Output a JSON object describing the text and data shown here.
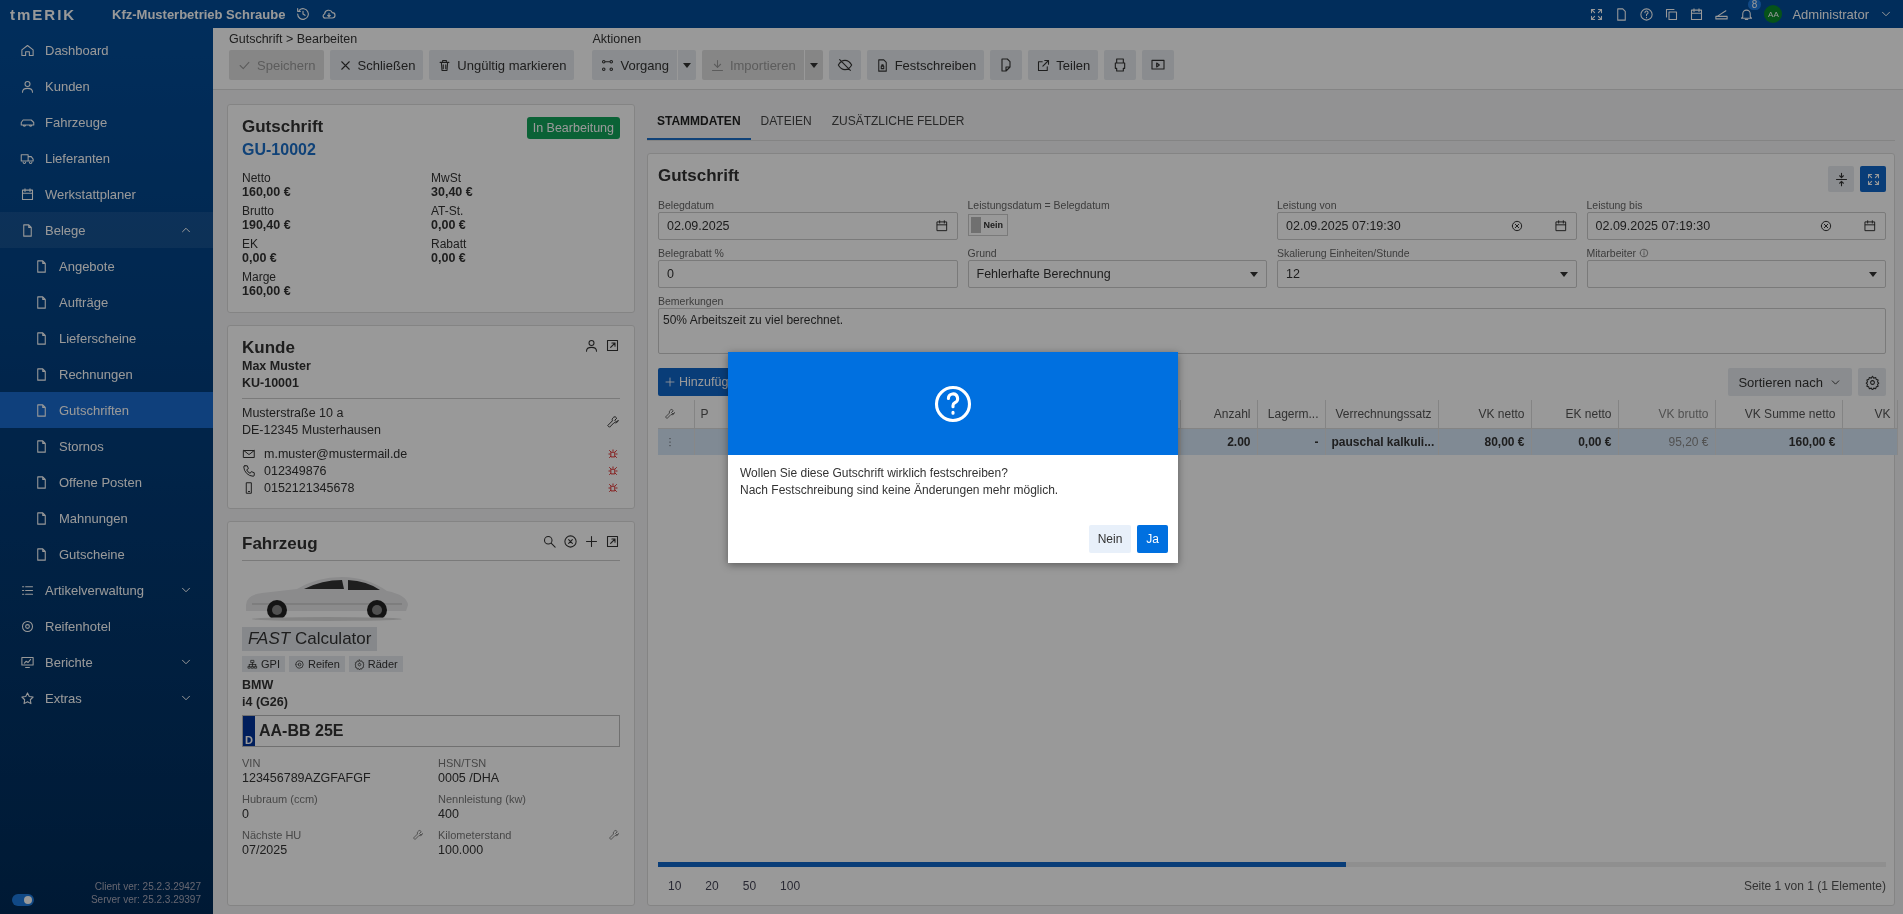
{
  "topbar": {
    "logo": "tmERIK",
    "company": "Kfz-Musterbetrieb Schraube",
    "notifications": "8",
    "avatar": "AA",
    "user": "Administrator"
  },
  "sidebar": {
    "items": [
      {
        "label": "Dashboard",
        "selected": false
      },
      {
        "label": "Kunden",
        "selected": false
      },
      {
        "label": "Fahrzeuge",
        "selected": false
      },
      {
        "label": "Lieferanten",
        "selected": false
      },
      {
        "label": "Werkstattplaner",
        "selected": false
      },
      {
        "label": "Belege",
        "selected": false,
        "expanded": true,
        "children": [
          {
            "label": "Angebote",
            "selected": false
          },
          {
            "label": "Aufträge",
            "selected": false
          },
          {
            "label": "Lieferscheine",
            "selected": false
          },
          {
            "label": "Rechnungen",
            "selected": false
          },
          {
            "label": "Gutschriften",
            "selected": true
          },
          {
            "label": "Stornos",
            "selected": false
          },
          {
            "label": "Offene Posten",
            "selected": false
          },
          {
            "label": "Mahnungen",
            "selected": false
          },
          {
            "label": "Gutscheine",
            "selected": false
          }
        ]
      },
      {
        "label": "Artikelverwaltung",
        "selected": false,
        "expanded": false
      },
      {
        "label": "Reifenhotel",
        "selected": false
      },
      {
        "label": "Berichte",
        "selected": false,
        "expanded": false
      },
      {
        "label": "Extras",
        "selected": false,
        "expanded": false
      }
    ],
    "toggle_on": true,
    "client_version": "Client ver: 25.2.3.29427",
    "server_version": "Server ver: 25.2.3.29397"
  },
  "toolbar": {
    "groups": [
      {
        "heading": "Gutschrift > Bearbeiten",
        "buttons": [
          {
            "kind": "button",
            "label": "Speichern",
            "disabled": true
          },
          {
            "kind": "button",
            "label": "Schließen",
            "disabled": false
          },
          {
            "kind": "button",
            "label": "Ungültig markieren",
            "disabled": false
          }
        ]
      },
      {
        "heading": "Aktionen",
        "buttons": [
          {
            "kind": "split",
            "label": "Vorgang",
            "disabled": false
          },
          {
            "kind": "split",
            "label": "Importieren",
            "disabled": true
          },
          {
            "kind": "icon",
            "disabled": false
          },
          {
            "kind": "button",
            "label": "Festschreiben",
            "disabled": false
          },
          {
            "kind": "icon",
            "disabled": false
          },
          {
            "kind": "button",
            "label": "Teilen",
            "disabled": false
          },
          {
            "kind": "icon",
            "disabled": false
          },
          {
            "kind": "icon",
            "disabled": false
          }
        ]
      }
    ]
  },
  "summary": {
    "title": "Gutschrift",
    "number": "GU-10002",
    "status": "In Bearbeitung",
    "figures": [
      {
        "label": "Netto",
        "value": "160,00 €"
      },
      {
        "label": "MwSt",
        "value": "30,40 €"
      },
      {
        "label": "Brutto",
        "value": "190,40 €"
      },
      {
        "label": "AT-St.",
        "value": "0,00 €"
      },
      {
        "label": "EK",
        "value": "0,00 €"
      },
      {
        "label": "Rabatt",
        "value": "0,00 €"
      },
      {
        "label": "Marge",
        "value": "160,00 €"
      }
    ]
  },
  "customer": {
    "title": "Kunde",
    "name": "Max Muster",
    "number": "KU-10001",
    "address": [
      "Musterstraße 10 a",
      "DE-12345 Musterhausen"
    ],
    "contacts": [
      {
        "kind": "email",
        "value": "m.muster@mustermail.de"
      },
      {
        "kind": "phone",
        "value": "012349876"
      },
      {
        "kind": "mobile",
        "value": "0152121345678"
      }
    ]
  },
  "vehicle": {
    "title": "Fahrzeug",
    "calculator": "*FAST* Calculator",
    "tags": [
      "GPI",
      "Reifen",
      "Räder"
    ],
    "make": "BMW",
    "model": "i4 (G26)",
    "plate_country": "D",
    "plate": "AA-BB 25E",
    "details": [
      {
        "label": "VIN",
        "value": "123456789AZGFAFGF",
        "editable": false
      },
      {
        "label": "HSN/TSN",
        "value": "0005 /DHA",
        "editable": false
      },
      {
        "label": "Hubraum (ccm)",
        "value": "0",
        "editable": false
      },
      {
        "label": "Nennleistung (kw)",
        "value": "400",
        "editable": false
      },
      {
        "label": "Nächste HU",
        "value": "07/2025",
        "editable": true
      },
      {
        "label": "Kilometerstand",
        "value": "100.000",
        "editable": true
      }
    ]
  },
  "tabs": [
    {
      "label": "STAMMDATEN",
      "selected": true
    },
    {
      "label": "DATEIEN",
      "selected": false
    },
    {
      "label": "ZUSÄTZLICHE FELDER",
      "selected": false
    }
  ],
  "form": {
    "title": "Gutschrift",
    "fields": [
      {
        "kind": "date",
        "label": "Belegdatum",
        "value": "02.09.2025"
      },
      {
        "kind": "toggle",
        "label": "Leistungsdatum = Belegdatum",
        "on": false,
        "value": "Nein"
      },
      {
        "kind": "datetime",
        "label": "Leistung von",
        "value": "02.09.2025 07:19:30"
      },
      {
        "kind": "datetime",
        "label": "Leistung bis",
        "value": "02.09.2025 07:19:30"
      },
      {
        "kind": "text",
        "label": "Belegrabatt %",
        "value": "0"
      },
      {
        "kind": "select",
        "label": "Grund",
        "value": "Fehlerhafte Berechnung"
      },
      {
        "kind": "select",
        "label": "Skalierung Einheiten/Stunde",
        "value": "12"
      },
      {
        "kind": "select",
        "label": "Mitarbeiter",
        "info": true
      }
    ],
    "remarks": {
      "label": "Bemerkungen",
      "value": "50% Arbeitszeit zu viel berechnet."
    }
  },
  "positions": {
    "add_button": "Hinzufüg",
    "sort_button": "Sortieren nach",
    "columns": [
      {
        "label": "P",
        "disabled": false
      },
      {
        "label": "Anzahl",
        "disabled": false
      },
      {
        "label": "Lagerm...",
        "disabled": false
      },
      {
        "label": "Verrechnungssatz",
        "disabled": false
      },
      {
        "label": "VK netto",
        "disabled": false
      },
      {
        "label": "EK netto",
        "disabled": false
      },
      {
        "label": "VK brutto",
        "disabled": true
      },
      {
        "label": "VK Summe netto",
        "disabled": false
      },
      {
        "label": "VK",
        "disabled": false
      }
    ],
    "rows": [
      {
        "selected": true,
        "cells": [
          "",
          "2.00",
          "-",
          "pauschal kalkuli...",
          "80,00 €",
          "0,00 €",
          "95,20 €",
          "160,00 €"
        ]
      }
    ],
    "page_sizes": [
      "10",
      "20",
      "50",
      "100"
    ],
    "page_info": "Seite 1 von 1 (1 Elemente)"
  },
  "dialog": {
    "lines": [
      "Wollen Sie diese Gutschrift wirklich festschreiben?",
      "Nach Festschreibung sind keine Änderungen mehr möglich."
    ],
    "buttons": [
      {
        "kind": "secondary",
        "label": "Nein"
      },
      {
        "kind": "primary",
        "label": "Ja"
      }
    ]
  }
}
